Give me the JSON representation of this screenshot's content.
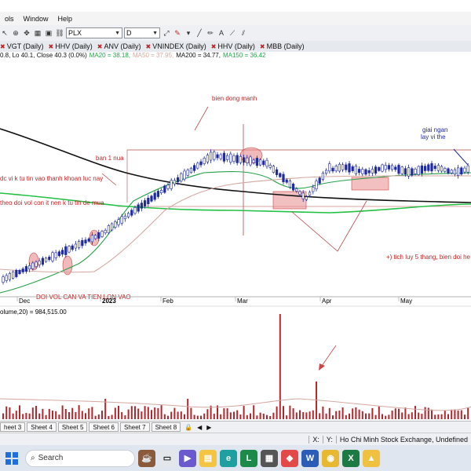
{
  "menu": [
    "ols",
    "Window",
    "Help"
  ],
  "toolbar": {
    "symbol": "PLX",
    "period": "D"
  },
  "chart_tabs": [
    "VGT (Daily)",
    "HHV (Daily)",
    "ANV (Daily)",
    "VNINDEX (Daily)",
    "HHV (Daily)",
    "MBB (Daily)"
  ],
  "info": {
    "ohlc": "0.8, Lo 40.1, Close 40.3 (0.0%)",
    "ma20": "MA20 = 38.18,",
    "ma50": "MA50 = 37.95,",
    "ma200": "MA200 = 34.77,",
    "ma150": "MA150 = 36.42"
  },
  "annotations": {
    "biendong": "bien dong manh",
    "ban1nua": "ban 1 nua",
    "dcvi": "dc vi k tu tin vao thanh khoan luc nay",
    "theodoi": "theo doi vol con it nen k tu tin de mua",
    "giaingan1": "giai ngan",
    "giaingan2": "lay vi the",
    "tichluy": "+) tich luy 5 thang, bien doi he",
    "doivol": "DOI VOL CAN VA TIEN LON VAO"
  },
  "xaxis": [
    "Dec",
    "2023",
    "Feb",
    "Mar",
    "Apr",
    "May"
  ],
  "volume_label": "olume,20) = 984,515.00",
  "sheets": [
    "heet 3",
    "Sheet 4",
    "Sheet 5",
    "Sheet 6",
    "Sheet 7",
    "Sheet 8"
  ],
  "status": {
    "x": "X:",
    "y": "Y:",
    "exchange": "Ho Chi Minh Stock Exchange, Undefined"
  },
  "taskbar": {
    "search": "Search"
  },
  "colors": {
    "ma20": "#21a84a",
    "ma50": "#c9a7a0",
    "ma200": "#111111",
    "ma150": "#22a84a",
    "candle_up": "#1f2b9c",
    "candle_down": "#2230a8",
    "annot": "#cc1f1f",
    "highlight": "#e88c8c"
  }
}
